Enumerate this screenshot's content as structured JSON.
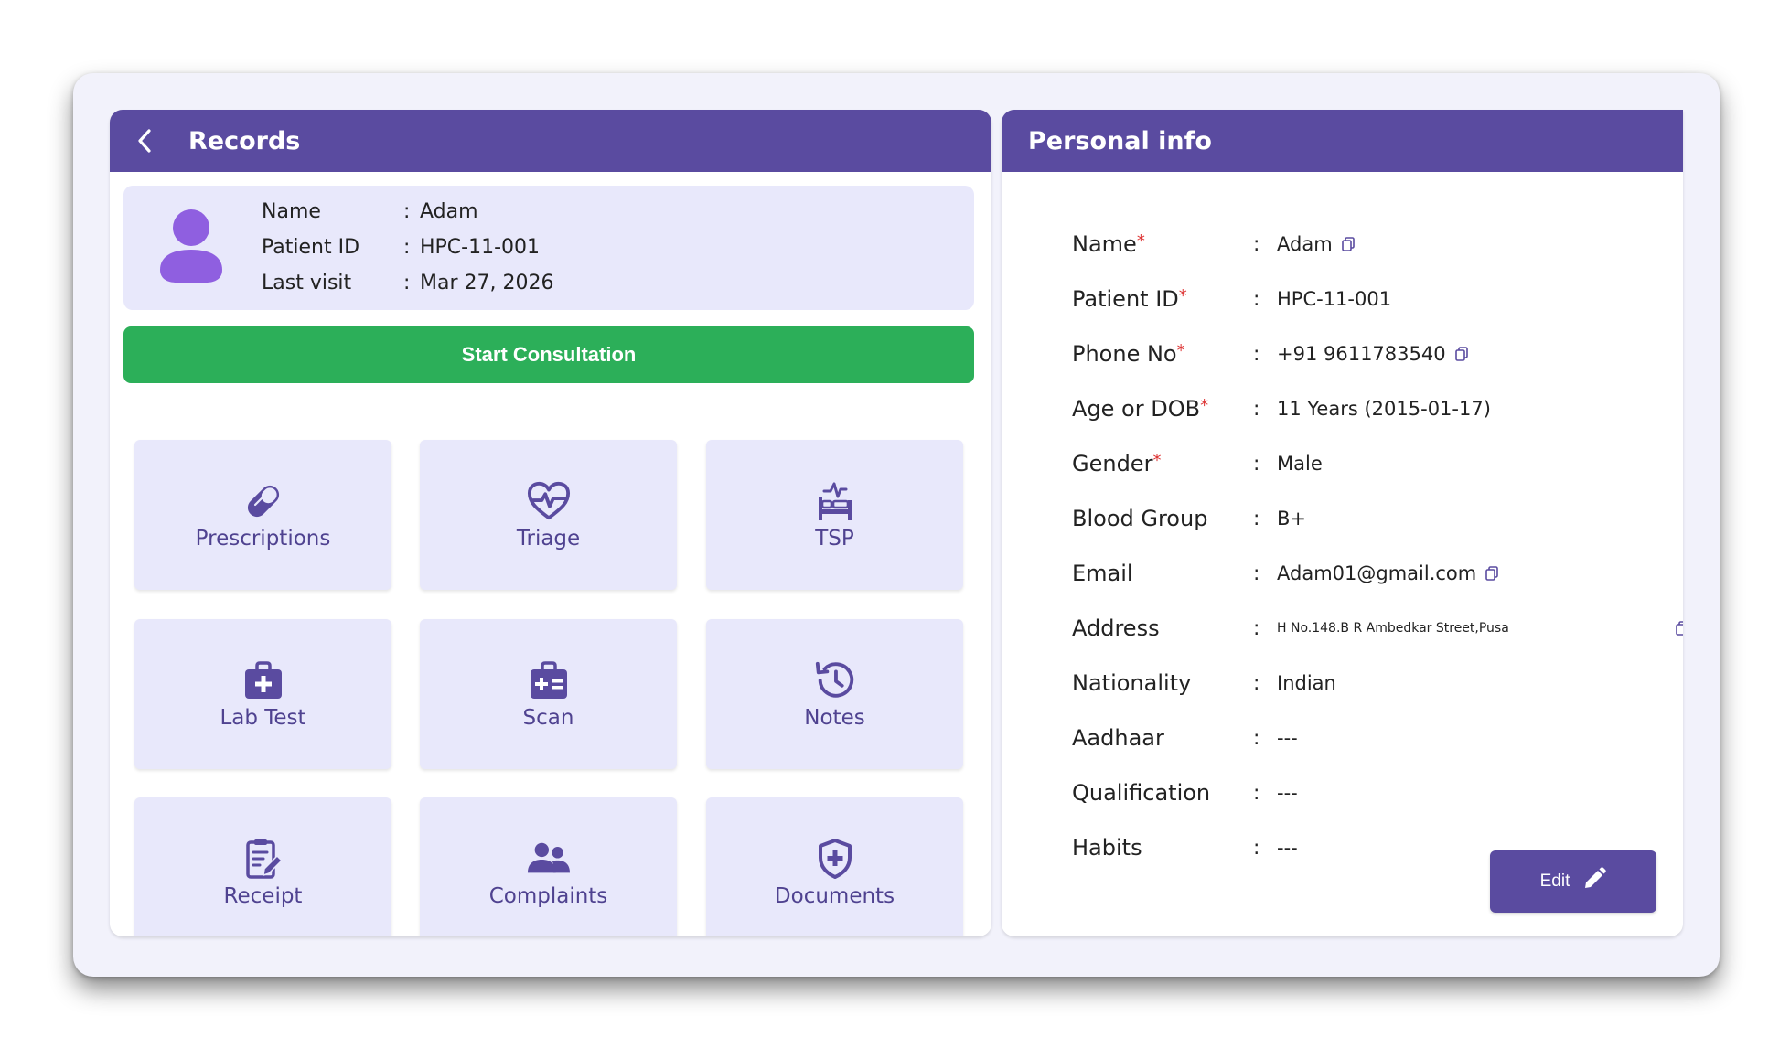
{
  "left_panel": {
    "title": "Records",
    "patient": {
      "rows": [
        {
          "label": "Name",
          "colon": ":",
          "value": "Adam"
        },
        {
          "label": "Patient ID",
          "colon": ":",
          "value": "HPC-11-001"
        },
        {
          "label": "Last visit",
          "colon": ":",
          "value": "Mar 27, 2026"
        }
      ]
    },
    "start_button": "Start Consultation",
    "tiles": [
      {
        "label": "Prescriptions",
        "icon": "pill-icon"
      },
      {
        "label": "Triage",
        "icon": "heartbeat-icon"
      },
      {
        "label": "TSP",
        "icon": "bed-pulse-icon"
      },
      {
        "label": "Lab Test",
        "icon": "medkit-icon"
      },
      {
        "label": "Scan",
        "icon": "medical-kit-icon"
      },
      {
        "label": "Notes",
        "icon": "history-clock-icon"
      },
      {
        "label": "Receipt",
        "icon": "receipt-edit-icon"
      },
      {
        "label": "Complaints",
        "icon": "users-icon"
      },
      {
        "label": "Documents",
        "icon": "shield-plus-icon"
      }
    ]
  },
  "right_panel": {
    "title": "Personal info",
    "fields": [
      {
        "label": "Name",
        "required": "*",
        "colon": ":",
        "value": "Adam"
      },
      {
        "label": "Patient ID",
        "required": "*",
        "colon": ":",
        "value": "HPC-11-001"
      },
      {
        "label": "Phone No",
        "required": "*",
        "colon": ":",
        "value": "+91 9611783540"
      },
      {
        "label": "Age or DOB",
        "required": "*",
        "colon": ":",
        "value": "11 Years (2015-01-17)"
      },
      {
        "label": "Gender",
        "required": "*",
        "colon": ":",
        "value": "Male"
      },
      {
        "label": "Blood Group",
        "colon": ":",
        "value": "B+"
      },
      {
        "label": "Email",
        "colon": ":",
        "value": "Adam01@gmail.com"
      },
      {
        "label": "Address",
        "colon": ":",
        "value": "H No.148.B R Ambedkar Street,Pusa"
      },
      {
        "label": "Nationality",
        "colon": ":",
        "value": "Indian"
      },
      {
        "label": "Aadhaar",
        "colon": ":",
        "value": "---"
      },
      {
        "label": "Qualification",
        "colon": ":",
        "value": "---"
      },
      {
        "label": "Habits",
        "colon": ":",
        "value": "---"
      }
    ],
    "edit_button": "Edit"
  },
  "colors": {
    "header": "#5a4ba0",
    "accent_icon": "#5a4ba0",
    "card_bg": "#e8e8fb",
    "start_button": "#2caf59",
    "avatar": "#8f5fe0",
    "required": "#dd3333"
  }
}
